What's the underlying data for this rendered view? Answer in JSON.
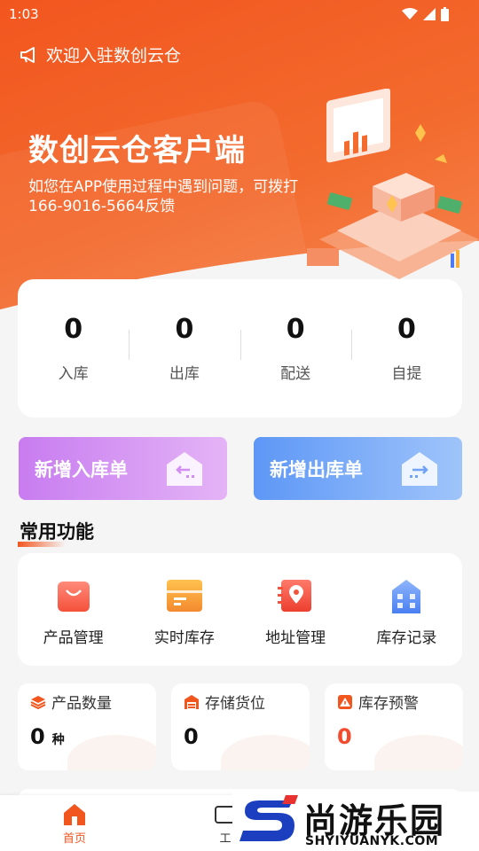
{
  "status_bar": {
    "time": "1:03"
  },
  "announcement": {
    "text": "欢迎入驻数创云仓"
  },
  "hero": {
    "title": "数创云仓客户端",
    "description": "如您在APP使用过程中遇到问题，可拨打166-9016-5664反馈"
  },
  "stats": [
    {
      "value": "0",
      "label": "入库"
    },
    {
      "value": "0",
      "label": "出库"
    },
    {
      "value": "0",
      "label": "配送"
    },
    {
      "value": "0",
      "label": "自提"
    }
  ],
  "order_buttons": {
    "inbound": "新增入库单",
    "outbound": "新增出库单"
  },
  "section": {
    "title": "常用功能"
  },
  "functions": [
    {
      "label": "产品管理",
      "icon": "shopping-bag-icon"
    },
    {
      "label": "实时库存",
      "icon": "box-icon"
    },
    {
      "label": "地址管理",
      "icon": "location-pin-icon"
    },
    {
      "label": "库存记录",
      "icon": "building-icon"
    }
  ],
  "summary_cards": [
    {
      "label": "产品数量",
      "value": "0",
      "unit": "种",
      "icon": "layers-icon"
    },
    {
      "label": "存储货位",
      "value": "0",
      "icon": "warehouse-icon"
    },
    {
      "label": "库存预警",
      "value": "0",
      "icon": "warning-icon",
      "value_color": "#f24b2e"
    }
  ],
  "tabbar": {
    "home": "首页",
    "work": "工"
  },
  "watermark": {
    "cn": "尚游乐园",
    "en": "SHYIYUANYK.COM"
  },
  "colors": {
    "accent": "#f2561f",
    "warning": "#f24b2e"
  }
}
